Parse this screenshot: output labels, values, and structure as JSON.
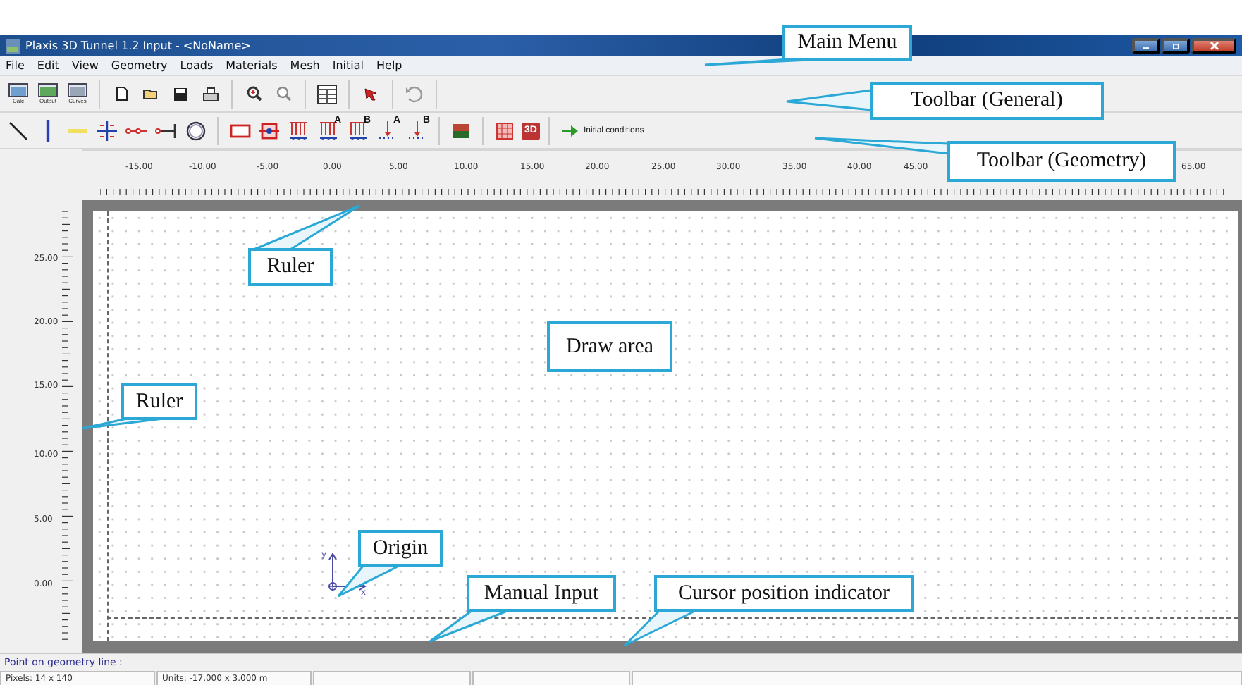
{
  "window": {
    "title": "Plaxis 3D Tunnel 1.2 Input - <NoName>"
  },
  "menu": [
    "File",
    "Edit",
    "View",
    "Geometry",
    "Loads",
    "Materials",
    "Mesh",
    "Initial",
    "Help"
  ],
  "toolbar_general": [
    {
      "kind": "calc",
      "label": "Calc"
    },
    {
      "kind": "output",
      "label": "Output"
    },
    {
      "kind": "curves",
      "label": "Curves"
    },
    {
      "kind": "sep"
    },
    {
      "kind": "new"
    },
    {
      "kind": "open"
    },
    {
      "kind": "save"
    },
    {
      "kind": "print"
    },
    {
      "kind": "sep"
    },
    {
      "kind": "zoomin"
    },
    {
      "kind": "zoomout"
    },
    {
      "kind": "sep"
    },
    {
      "kind": "table"
    },
    {
      "kind": "sep"
    },
    {
      "kind": "pointer"
    },
    {
      "kind": "sep"
    },
    {
      "kind": "undo"
    },
    {
      "kind": "sep"
    }
  ],
  "toolbar_geometry": [
    {
      "kind": "line"
    },
    {
      "kind": "plate"
    },
    {
      "kind": "interface"
    },
    {
      "kind": "fixities"
    },
    {
      "kind": "spring"
    },
    {
      "kind": "anchor"
    },
    {
      "kind": "tunnel"
    },
    {
      "kind": "sep"
    },
    {
      "kind": "rect"
    },
    {
      "kind": "node"
    },
    {
      "kind": "dload"
    },
    {
      "kind": "dload",
      "label": "A"
    },
    {
      "kind": "dload",
      "label": "B"
    },
    {
      "kind": "pload",
      "label": "A"
    },
    {
      "kind": "pload",
      "label": "B"
    },
    {
      "kind": "sep"
    },
    {
      "kind": "material"
    },
    {
      "kind": "sep"
    },
    {
      "kind": "mesh"
    },
    {
      "kind": "threed",
      "label": "3D"
    },
    {
      "kind": "sep"
    },
    {
      "kind": "next",
      "label": "Initial conditions"
    }
  ],
  "rulers": {
    "horizontal": [
      "-15.00",
      "-10.00",
      "-5.00",
      "0.00",
      "5.00",
      "10.00",
      "15.00",
      "20.00",
      "25.00",
      "30.00",
      "35.00",
      "40.00",
      "45.00",
      "65.00"
    ],
    "vertical": [
      "25.00",
      "20.00",
      "15.00",
      "10.00",
      "5.00",
      "0.00"
    ]
  },
  "origin": {
    "y_label": "y",
    "x_label": "x"
  },
  "status": {
    "prompt": "Point on geometry line :",
    "fields": [
      "Pixels: 14 x 140",
      "Units: -17.000 x 3.000 m"
    ]
  },
  "callouts": [
    {
      "text": "Main Menu"
    },
    {
      "text": "Toolbar (General)"
    },
    {
      "text": "Toolbar (Geometry)"
    },
    {
      "text": "Ruler"
    },
    {
      "text": "Ruler"
    },
    {
      "text": "Draw area"
    },
    {
      "text": "Origin"
    },
    {
      "text": "Manual Input"
    },
    {
      "text": "Cursor position indicator"
    }
  ]
}
